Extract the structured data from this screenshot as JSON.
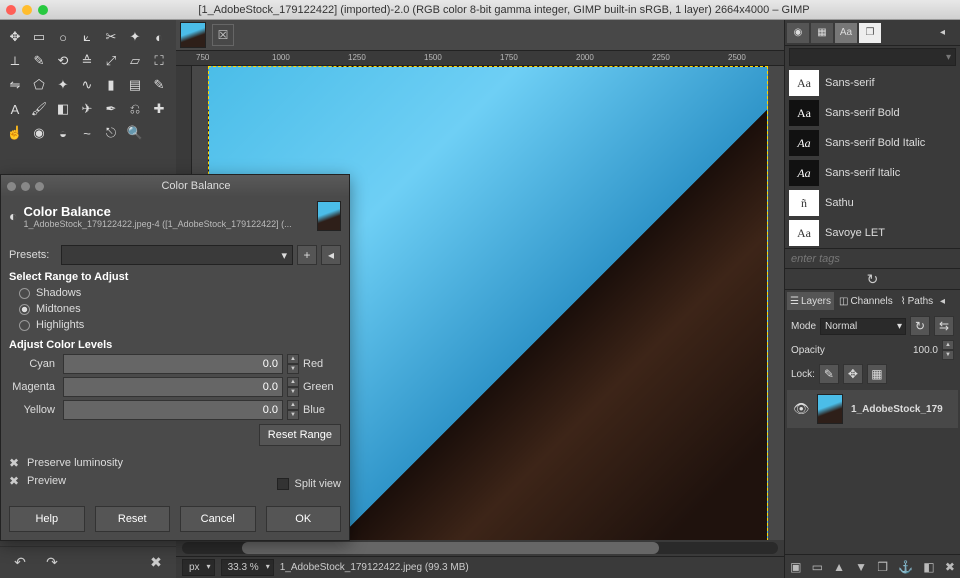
{
  "titlebar": {
    "title": "[1_AdobeStock_179122422] (imported)-2.0 (RGB color 8-bit gamma integer, GIMP built-in sRGB, 1 layer) 2664x4000 – GIMP"
  },
  "ruler": {
    "ticks": [
      "750",
      "1000",
      "1250",
      "1500",
      "1750",
      "2000",
      "2250",
      "2500"
    ]
  },
  "status": {
    "unit": "px",
    "zoom": "33.3 %",
    "file": "1_AdobeStock_179122422.jpeg (99.3 MB)"
  },
  "fonts": {
    "items": [
      {
        "sample": "Aa",
        "name": "Sans-serif",
        "light": true
      },
      {
        "sample": "Aa",
        "name": "Sans-serif Bold",
        "light": false
      },
      {
        "sample": "Aa",
        "name": "Sans-serif Bold Italic",
        "light": false
      },
      {
        "sample": "Aa",
        "name": "Sans-serif Italic",
        "light": false
      },
      {
        "sample": "ñ",
        "name": "Sathu",
        "light": true
      },
      {
        "sample": "Aa",
        "name": "Savoye LET",
        "light": true
      }
    ],
    "tags_placeholder": "enter tags"
  },
  "layers": {
    "tabs": {
      "layers": "Layers",
      "channels": "Channels",
      "paths": "Paths"
    },
    "mode_label": "Mode",
    "mode_value": "Normal",
    "opacity_label": "Opacity",
    "opacity_value": "100.0",
    "lock_label": "Lock:",
    "entry_name": "1_AdobeStock_179"
  },
  "dialog": {
    "window_title": "Color Balance",
    "heading": "Color Balance",
    "subheading": "1_AdobeStock_179122422.jpeg-4 ([1_AdobeStock_179122422] (...",
    "presets_label": "Presets:",
    "range_title": "Select Range to Adjust",
    "range": {
      "shadows": "Shadows",
      "midtones": "Midtones",
      "highlights": "Highlights"
    },
    "levels_title": "Adjust Color Levels",
    "sliders": [
      {
        "left": "Cyan",
        "value": "0.0",
        "right": "Red"
      },
      {
        "left": "Magenta",
        "value": "0.0",
        "right": "Green"
      },
      {
        "left": "Yellow",
        "value": "0.0",
        "right": "Blue"
      }
    ],
    "reset_range": "Reset Range",
    "preserve": "Preserve luminosity",
    "preview": "Preview",
    "split_view": "Split view",
    "buttons": {
      "help": "Help",
      "reset": "Reset",
      "cancel": "Cancel",
      "ok": "OK"
    }
  }
}
